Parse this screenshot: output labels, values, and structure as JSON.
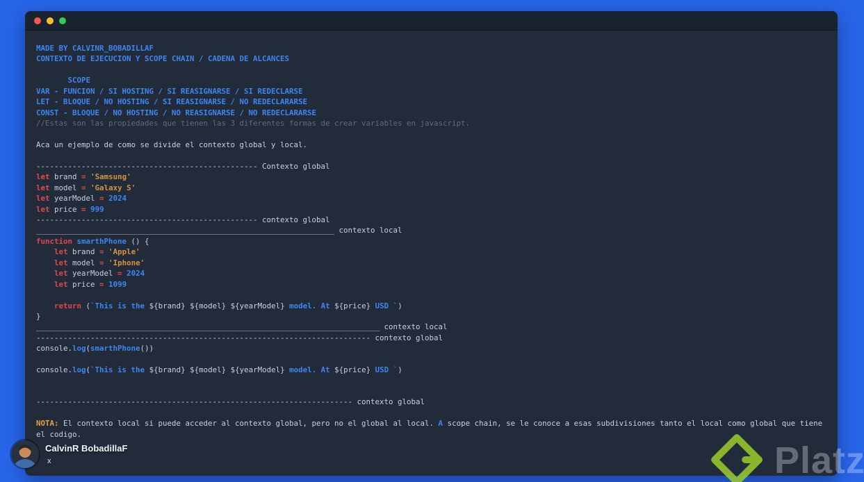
{
  "colors": {
    "desktop": "#2765e9",
    "window": "#212b3a",
    "titlebar": "#19222f",
    "blue": "#3e86f0",
    "red": "#e0484a",
    "string": "#d6933f",
    "label": "#e9a13b",
    "comment": "#5f6b7d",
    "plain": "#c9d1de",
    "tl_red": "#f85550",
    "tl_yellow": "#f7bd2e",
    "tl_green": "#2ecc51",
    "platzi_green": "#9ccd2a",
    "name_text": "#f5f7fa"
  },
  "window": {
    "controls": [
      "close-window",
      "minimize-window",
      "zoom-window"
    ]
  },
  "presenter": {
    "name": "CalvinR BobadillaF",
    "sub": "x"
  },
  "watermark": {
    "brand": "Platzi"
  },
  "code": {
    "lines": [
      [
        [
          "b",
          "MADE BY CALVINR_BOBADILLAF"
        ]
      ],
      [
        [
          "b",
          "CONTEXTO DE EJECUCION Y SCOPE CHAIN / CADENA DE ALCANCES"
        ]
      ],
      [],
      [
        [
          "b",
          "       SCOPE"
        ]
      ],
      [
        [
          "b",
          "VAR - FUNCION / SI HOSTING / SI REASIGNARSE / SI REDECLARSE"
        ]
      ],
      [
        [
          "b",
          "LET - BLOQUE / NO HOSTING / SI REASIGNARSE / NO REDECLARARSE"
        ]
      ],
      [
        [
          "b",
          "CONST - BLOQUE / NO HOSTING / NO REASIGNARSE / NO REDECLARARSE"
        ]
      ],
      [
        [
          "c",
          "//Estas son las propiedades que tienen las 3 diferentes formas de crear variables en javascript."
        ]
      ],
      [],
      [
        [
          "p",
          "Aca un ejemplo de como se divide el contexto global y local."
        ]
      ],
      [],
      [
        [
          "p",
          "------------------------------------------------- Contexto global"
        ]
      ],
      [
        [
          "k",
          "let"
        ],
        [
          "p",
          " brand "
        ],
        [
          "k",
          "="
        ],
        [
          "p",
          " "
        ],
        [
          "s",
          "'Samsung'"
        ]
      ],
      [
        [
          "k",
          "let"
        ],
        [
          "p",
          " model "
        ],
        [
          "k",
          "="
        ],
        [
          "p",
          " "
        ],
        [
          "s",
          "'Galaxy S'"
        ]
      ],
      [
        [
          "k",
          "let"
        ],
        [
          "p",
          " yearModel "
        ],
        [
          "k",
          "="
        ],
        [
          "p",
          " "
        ],
        [
          "b",
          "2024"
        ]
      ],
      [
        [
          "k",
          "let"
        ],
        [
          "p",
          " price "
        ],
        [
          "k",
          "="
        ],
        [
          "p",
          " "
        ],
        [
          "b",
          "999"
        ]
      ],
      [
        [
          "p",
          "------------------------------------------------- contexto global"
        ]
      ],
      [
        [
          "p",
          "__________________________________________________________________ contexto local"
        ]
      ],
      [
        [
          "k",
          "function"
        ],
        [
          "p",
          " "
        ],
        [
          "b",
          "smarthPhone"
        ],
        [
          "p",
          " () {"
        ]
      ],
      [
        [
          "p",
          "    "
        ],
        [
          "k",
          "let"
        ],
        [
          "p",
          " brand "
        ],
        [
          "k",
          "="
        ],
        [
          "p",
          " "
        ],
        [
          "s",
          "'Apple'"
        ]
      ],
      [
        [
          "p",
          "    "
        ],
        [
          "k",
          "let"
        ],
        [
          "p",
          " model "
        ],
        [
          "k",
          "="
        ],
        [
          "p",
          " "
        ],
        [
          "s",
          "'Iphone'"
        ]
      ],
      [
        [
          "p",
          "    "
        ],
        [
          "k",
          "let"
        ],
        [
          "p",
          " yearModel "
        ],
        [
          "k",
          "="
        ],
        [
          "p",
          " "
        ],
        [
          "b",
          "2024"
        ]
      ],
      [
        [
          "p",
          "    "
        ],
        [
          "k",
          "let"
        ],
        [
          "p",
          " price "
        ],
        [
          "k",
          "="
        ],
        [
          "p",
          " "
        ],
        [
          "b",
          "1099"
        ]
      ],
      [],
      [
        [
          "p",
          "    "
        ],
        [
          "k",
          "return"
        ],
        [
          "p",
          " ("
        ],
        [
          "b",
          "`This is the "
        ],
        [
          "p",
          "${brand}"
        ],
        [
          "b",
          " "
        ],
        [
          "p",
          "${model}"
        ],
        [
          "b",
          " "
        ],
        [
          "p",
          "${yearModel}"
        ],
        [
          "b",
          " model. At "
        ],
        [
          "p",
          "${price}"
        ],
        [
          "b",
          " USD `"
        ],
        [
          "p",
          ")"
        ]
      ],
      [
        [
          "p",
          "}"
        ]
      ],
      [
        [
          "p",
          "____________________________________________________________________________ contexto local"
        ]
      ],
      [
        [
          "p",
          "-------------------------------------------------------------------------- contexto global"
        ]
      ],
      [
        [
          "p",
          "console."
        ],
        [
          "b",
          "log"
        ],
        [
          "p",
          "("
        ],
        [
          "b",
          "smarthPhone"
        ],
        [
          "p",
          "())"
        ]
      ],
      [],
      [
        [
          "p",
          "console."
        ],
        [
          "b",
          "log"
        ],
        [
          "p",
          "("
        ],
        [
          "b",
          "`This is the "
        ],
        [
          "p",
          "${brand}"
        ],
        [
          "b",
          " "
        ],
        [
          "p",
          "${model}"
        ],
        [
          "b",
          " "
        ],
        [
          "p",
          "${yearModel}"
        ],
        [
          "b",
          " model. At "
        ],
        [
          "p",
          "${price}"
        ],
        [
          "b",
          " USD `"
        ],
        [
          "p",
          ")"
        ]
      ],
      [],
      [],
      [
        [
          "p",
          "---------------------------------------------------------------------- contexto global"
        ]
      ],
      [],
      [
        [
          "o",
          "NOTA:"
        ],
        [
          "p",
          " El contexto local si puede acceder al contexto global, pero no el global al local. "
        ],
        [
          "b",
          "A"
        ],
        [
          "p",
          " scope chain, se le conoce a esas subdivisiones tanto el local como global que tiene"
        ]
      ],
      [
        [
          "p",
          "el codigo."
        ]
      ]
    ]
  }
}
